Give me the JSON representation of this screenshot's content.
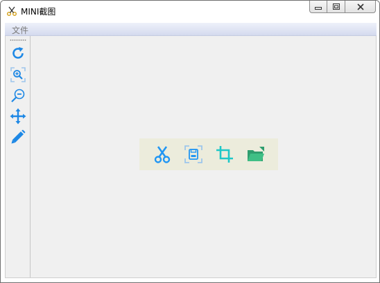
{
  "window": {
    "title": "MINI截图",
    "app_icon": "scissors-app-icon",
    "caption_buttons": [
      "minimize-icon",
      "maximize-icon",
      "close-icon"
    ]
  },
  "menubar": {
    "items": [
      {
        "label": "文件"
      }
    ]
  },
  "left_toolbar": {
    "tools": [
      {
        "name": "rotate-icon"
      },
      {
        "name": "zoom-in-icon"
      },
      {
        "name": "zoom-out-icon"
      },
      {
        "name": "move-icon"
      },
      {
        "name": "pen-icon"
      }
    ]
  },
  "action_panel": {
    "buttons": [
      {
        "name": "capture-scissors-icon",
        "color": "#2196f3"
      },
      {
        "name": "save-icon",
        "color": "#2196f3"
      },
      {
        "name": "crop-icon",
        "color": "#1ec8c8"
      },
      {
        "name": "open-folder-icon",
        "color": "#2f9e6e"
      }
    ]
  },
  "colors": {
    "accent_blue": "#1e88e5",
    "panel_background": "#ececdc",
    "client_background": "#f0f0f0"
  }
}
